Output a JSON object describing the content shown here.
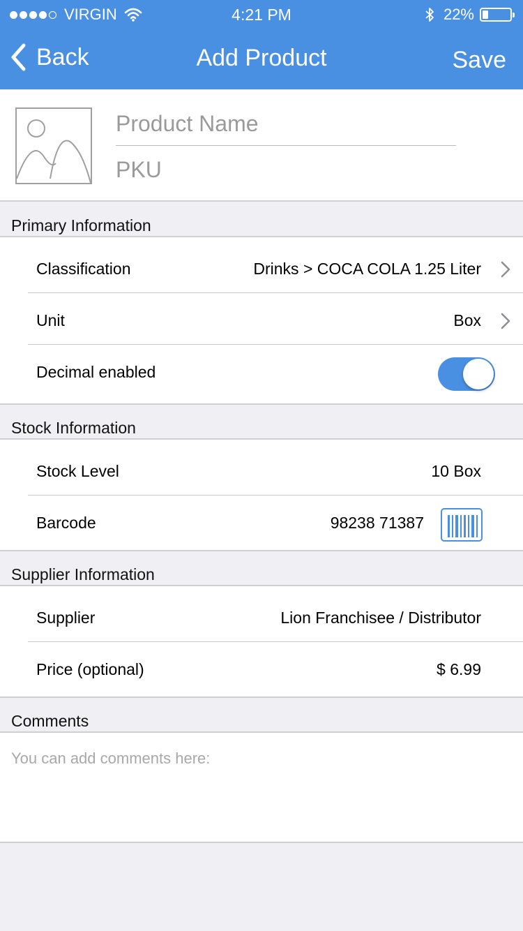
{
  "status_bar": {
    "carrier": "VIRGIN",
    "time": "4:21 PM",
    "battery": "22%",
    "battery_level": 0.22,
    "signal_bars": 4,
    "signal_total": 5
  },
  "nav": {
    "back_label": "Back",
    "title": "Add Product",
    "save_label": "Save"
  },
  "product": {
    "name_placeholder": "Product Name",
    "pku_placeholder": "PKU"
  },
  "primary": {
    "header": "Primary Information",
    "classification_label": "Classification",
    "classification_value": "Drinks > COCA COLA 1.25 Liter",
    "unit_label": "Unit",
    "unit_value": "Box",
    "decimal_label": "Decimal enabled",
    "decimal_enabled": true
  },
  "stock": {
    "header": "Stock Information",
    "level_label": "Stock Level",
    "level_value": "10 Box",
    "barcode_label": "Barcode",
    "barcode_value": "98238 71387"
  },
  "supplier": {
    "header": "Supplier Information",
    "supplier_label": "Supplier",
    "supplier_value": "Lion Franchisee / Distributor",
    "price_label": "Price (optional)",
    "price_value": "$ 6.99"
  },
  "comments": {
    "header": "Comments",
    "placeholder": "You can add comments here:"
  },
  "colors": {
    "accent": "#4a90e2",
    "background": "#efeff4"
  },
  "icons": [
    "signal-dots-icon",
    "wifi-icon",
    "bluetooth-icon",
    "battery-icon",
    "back-chevron-icon",
    "image-placeholder-icon",
    "chevron-right-icon",
    "barcode-icon"
  ]
}
